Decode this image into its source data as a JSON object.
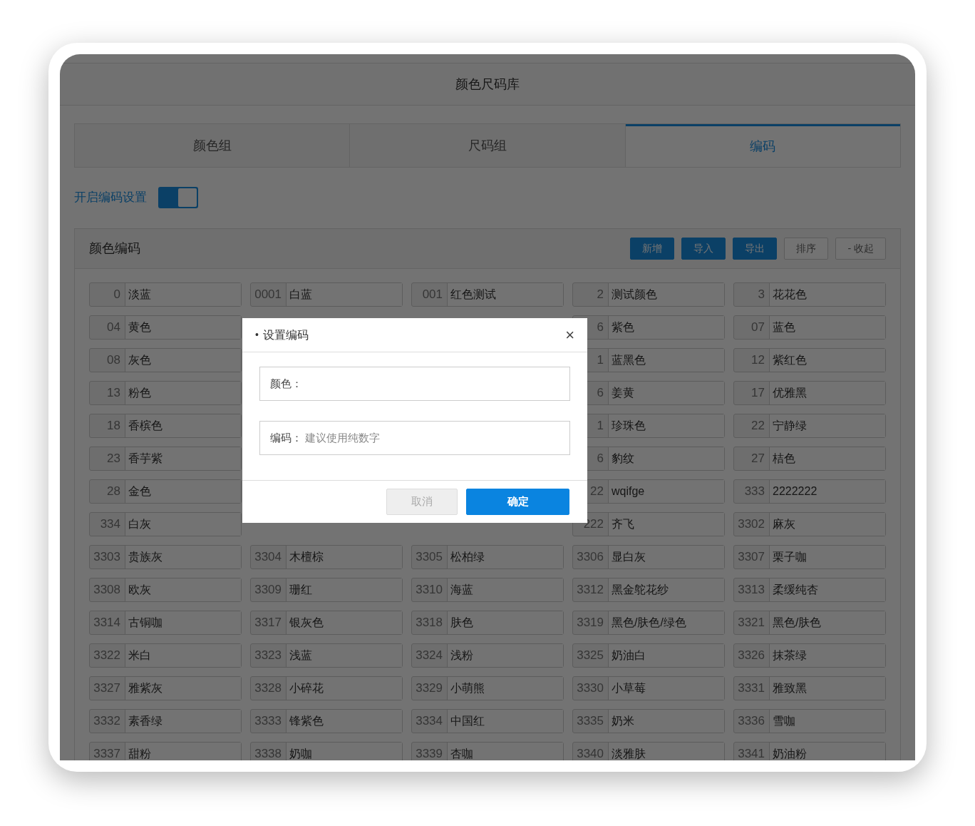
{
  "window": {
    "title": "颜色尺码库"
  },
  "tabs": [
    {
      "label": "颜色组",
      "selected": false
    },
    {
      "label": "尺码组",
      "selected": false
    },
    {
      "label": "编码",
      "selected": true
    }
  ],
  "coding_toggle": {
    "label": "开启编码设置",
    "on": true
  },
  "panel": {
    "title": "颜色编码",
    "buttons": [
      {
        "label": "新增",
        "kind": "primary"
      },
      {
        "label": "导入",
        "kind": "primary"
      },
      {
        "label": "导出",
        "kind": "primary"
      },
      {
        "label": "排序",
        "kind": "default"
      },
      {
        "label": "- 收起",
        "kind": "default"
      }
    ],
    "rows": [
      [
        {
          "code": "0",
          "name": "淡蓝"
        },
        {
          "code": "0001",
          "name": "白蓝"
        },
        {
          "code": "001",
          "name": "红色测试"
        },
        {
          "code": "2",
          "name": "测试颜色"
        },
        {
          "code": "3",
          "name": "花花色"
        }
      ],
      [
        {
          "code": "04",
          "name": "黄色"
        },
        null,
        null,
        {
          "code": "6",
          "name": "紫色"
        },
        {
          "code": "07",
          "name": "蓝色"
        }
      ],
      [
        {
          "code": "08",
          "name": "灰色"
        },
        null,
        null,
        {
          "code": "1",
          "name": "蓝黑色"
        },
        {
          "code": "12",
          "name": "紫红色"
        }
      ],
      [
        {
          "code": "13",
          "name": "粉色"
        },
        null,
        null,
        {
          "code": "6",
          "name": "姜黄"
        },
        {
          "code": "17",
          "name": "优雅黑"
        }
      ],
      [
        {
          "code": "18",
          "name": "香槟色"
        },
        null,
        null,
        {
          "code": "1",
          "name": "珍珠色"
        },
        {
          "code": "22",
          "name": "宁静绿"
        }
      ],
      [
        {
          "code": "23",
          "name": "香芋紫"
        },
        null,
        null,
        {
          "code": "6",
          "name": "豹纹"
        },
        {
          "code": "27",
          "name": "桔色"
        }
      ],
      [
        {
          "code": "28",
          "name": "金色"
        },
        null,
        null,
        {
          "code": "22",
          "name": "wqifge"
        },
        {
          "code": "333",
          "name": "2222222"
        }
      ],
      [
        {
          "code": "334",
          "name": "白灰"
        },
        null,
        null,
        {
          "code": "222",
          "name": "齐飞"
        },
        {
          "code": "3302",
          "name": "麻灰"
        }
      ],
      [
        {
          "code": "3303",
          "name": "贵族灰"
        },
        {
          "code": "3304",
          "name": "木檀棕"
        },
        {
          "code": "3305",
          "name": "松柏绿"
        },
        {
          "code": "3306",
          "name": "显白灰"
        },
        {
          "code": "3307",
          "name": "栗子咖"
        }
      ],
      [
        {
          "code": "3308",
          "name": "欧灰"
        },
        {
          "code": "3309",
          "name": "珊红"
        },
        {
          "code": "3310",
          "name": "海蓝"
        },
        {
          "code": "3312",
          "name": "黑金鸵花纱"
        },
        {
          "code": "3313",
          "name": "柔缓纯杏"
        }
      ],
      [
        {
          "code": "3314",
          "name": "古铜咖"
        },
        {
          "code": "3317",
          "name": "银灰色"
        },
        {
          "code": "3318",
          "name": "肤色"
        },
        {
          "code": "3319",
          "name": "黑色/肤色/绿色"
        },
        {
          "code": "3321",
          "name": "黑色/肤色"
        }
      ],
      [
        {
          "code": "3322",
          "name": "米白"
        },
        {
          "code": "3323",
          "name": "浅蓝"
        },
        {
          "code": "3324",
          "name": "浅粉"
        },
        {
          "code": "3325",
          "name": "奶油白"
        },
        {
          "code": "3326",
          "name": "抹茶绿"
        }
      ],
      [
        {
          "code": "3327",
          "name": "雅紫灰"
        },
        {
          "code": "3328",
          "name": "小碎花"
        },
        {
          "code": "3329",
          "name": "小萌熊"
        },
        {
          "code": "3330",
          "name": "小草莓"
        },
        {
          "code": "3331",
          "name": "雅致黑"
        }
      ],
      [
        {
          "code": "3332",
          "name": "素香绿"
        },
        {
          "code": "3333",
          "name": "锋紫色"
        },
        {
          "code": "3334",
          "name": "中国红"
        },
        {
          "code": "3335",
          "name": "奶米"
        },
        {
          "code": "3336",
          "name": "雪咖"
        }
      ],
      [
        {
          "code": "3337",
          "name": "甜粉"
        },
        {
          "code": "3338",
          "name": "奶咖"
        },
        {
          "code": "3339",
          "name": "杏咖"
        },
        {
          "code": "3340",
          "name": "淡雅肤"
        },
        {
          "code": "3341",
          "name": "奶油粉"
        }
      ]
    ]
  },
  "dialog": {
    "title": "设置编码",
    "bullet": "•",
    "close": "×",
    "fields": [
      {
        "label": "颜色："
      },
      {
        "label": "编码：",
        "placeholder": "建议使用纯数字"
      }
    ],
    "buttons": [
      {
        "label": "取消",
        "kind": "default"
      },
      {
        "label": "确定",
        "kind": "primary"
      }
    ]
  }
}
